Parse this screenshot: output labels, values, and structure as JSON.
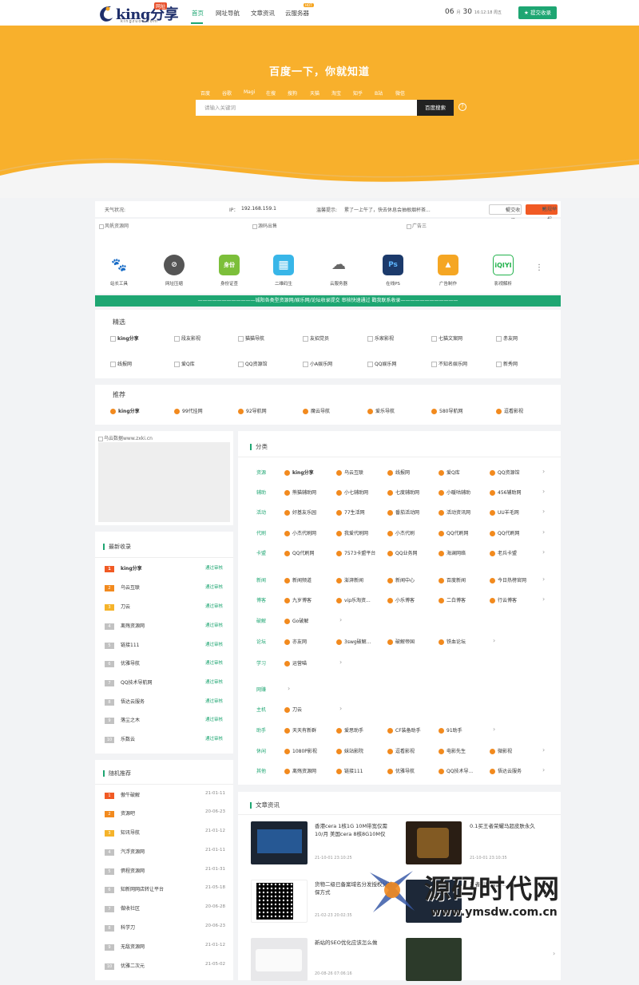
{
  "header": {
    "logo_text": "king分享",
    "logo_sub": "kingzuoo.com",
    "logo_tag": "网址",
    "nav": [
      "首页",
      "网址导航",
      "文章资讯",
      "云服务器"
    ],
    "hot_badge": "HOT",
    "date": {
      "month": "06",
      "month_unit": "月",
      "day": "30",
      "time_week": "16:12:18 周五"
    },
    "submit_label": "提交收录",
    "accent": "#1ea672"
  },
  "hero": {
    "title": "百度一下，你就知道",
    "engines": [
      "百度",
      "谷歌",
      "Magi",
      "在搜",
      "搜狗",
      "天猫",
      "淘宝",
      "知乎",
      "B站",
      "微信"
    ],
    "search_placeholder": "请输入关键词",
    "search_button": "百度搜索",
    "help": "?",
    "bg": "#f8b02c"
  },
  "info": {
    "weather_label": "天气状况:",
    "ip_label": "IP：",
    "ip_value": "192.168.159.1",
    "tip_label": "温馨提示:",
    "tip_text": "累了一上午了，快去休息会抽根烟杯茶...",
    "submit_btn": "提交收录",
    "report_btn": "违规举报"
  },
  "ads": [
    "风帆资源网",
    "源码出售",
    "广告三"
  ],
  "tools": [
    {
      "label": "站长工具",
      "icon": "paw-icon",
      "glyph": "🐾",
      "color": "#2b6fd6"
    },
    {
      "label": "网址压缩",
      "icon": "link-icon",
      "glyph": "⊘",
      "color": "#555555"
    },
    {
      "label": "身份证查",
      "icon": "id-card-icon",
      "glyph": "身份",
      "color": "#7cbf3a"
    },
    {
      "label": "二维码生",
      "icon": "qrcode-icon",
      "glyph": "▦",
      "color": "#38b6e8"
    },
    {
      "label": "云服务器",
      "icon": "cloud-icon",
      "glyph": "☁",
      "color": "#777777"
    },
    {
      "label": "在线PS",
      "icon": "ps-icon",
      "glyph": "Ps",
      "color": "#1c3a6b"
    },
    {
      "label": "广告制作",
      "icon": "image-icon",
      "glyph": "▲",
      "color": "#f5a623"
    },
    {
      "label": "影视解析",
      "icon": "iqiyi-icon",
      "glyph": "iQIYI",
      "color": "#22b24c"
    }
  ],
  "more": "⋮",
  "banner_text": "————————————城阳各类型资源网/娱乐网/论坛收录提交 审核快速通过 戳我联系收录————————————",
  "featured": {
    "title": "精选",
    "rows": [
      [
        "king分享",
        "段友影视",
        "猫猫导航",
        "友招党员",
        "乐家影视",
        "七猫文案网",
        "赤友网"
      ],
      [
        "线报网",
        "爱Q库",
        "QQ资源馆",
        "小A娱乐网",
        "QQ娱乐网",
        "不知名娱乐网",
        "新秀网"
      ]
    ]
  },
  "recommend": {
    "title": "推荐",
    "items": [
      "king分享",
      "99代挂网",
      "92导航网",
      "魔云导航",
      "爱乐导航",
      "580导航网",
      "逗看影视"
    ]
  },
  "left_ad": "乌云数据www.zxki.cn",
  "latest": {
    "title": "最新收录",
    "items": [
      "king分享",
      "乌云互联",
      "刀云",
      "离殇资源网",
      "链接111",
      "优雅导航",
      "QQ技术导航网",
      "悟达云服务",
      "落尘之木",
      "乐数云"
    ],
    "status": "通过审核"
  },
  "random": {
    "title": "随机推荐",
    "items": [
      {
        "name": "傲牛破解",
        "date": "21-01-11"
      },
      {
        "name": "资源吧",
        "date": "20-06-23"
      },
      {
        "name": "知讯导航",
        "date": "21-01-12"
      },
      {
        "name": "汽浮资源网",
        "date": "21-01-11"
      },
      {
        "name": "倶程资源网",
        "date": "21-01-31"
      },
      {
        "name": "知新网网店转让平台",
        "date": "21-05-18"
      },
      {
        "name": "做收社区",
        "date": "20-06-28"
      },
      {
        "name": "科学刀",
        "date": "20-06-23"
      },
      {
        "name": "无敌资源网",
        "date": "21-01-12"
      },
      {
        "name": "优雅二次元",
        "date": "21-05-02"
      }
    ]
  },
  "category": {
    "title": "分类",
    "rows": [
      {
        "label": "资源",
        "items": [
          "king分享",
          "乌云互联",
          "线报网",
          "爱Q库",
          "QQ资源馆"
        ]
      },
      {
        "label": "辅助",
        "items": [
          "熊猫辅助网",
          "小七辅助网",
          "七度辅助网",
          "小暖咕辅助",
          "456辅助网"
        ]
      },
      {
        "label": "活动",
        "items": [
          "好基友乐园",
          "77生活网",
          "番茄活动网",
          "活动资讯网",
          "UU羊毛网"
        ]
      },
      {
        "label": "代刷",
        "items": [
          "小杰代刷网",
          "我爱代刷网",
          "小杰代刷",
          "QQ代刷网",
          "QQ代刷网"
        ]
      },
      {
        "label": "卡盟",
        "items": [
          "QQ代刷网",
          "7573卡盟平台",
          "QQ业务网",
          "海澜网络",
          "老兵卡盟"
        ]
      },
      {
        "label": "新闻",
        "items": [
          "新闻频道",
          "澎湃新闻",
          "新闻中心",
          "百度新闻",
          "今日热榜官网"
        ]
      },
      {
        "label": "博客",
        "items": [
          "九岁博客",
          "vip乐淘资...",
          "小乐博客",
          "二白博客",
          "行云博客"
        ]
      },
      {
        "label": "破解",
        "items": [
          "Go破解"
        ]
      },
      {
        "label": "论坛",
        "items": [
          "亦友网",
          "3swg破解...",
          "破解帝国",
          "铁血论坛"
        ]
      },
      {
        "label": "学习",
        "items": [
          "运营喵"
        ]
      },
      {
        "label": "网赚",
        "items": []
      },
      {
        "label": "主机",
        "items": [
          "刀云"
        ]
      },
      {
        "label": "助手",
        "items": [
          "天天有新群",
          "爱思助手",
          "CF装备助手",
          "91助手"
        ]
      },
      {
        "label": "休闲",
        "items": [
          "1080P影视",
          "妹站影院",
          "逗看影视",
          "电影先生",
          "微影视"
        ]
      },
      {
        "label": "其他",
        "items": [
          "离殇资源网",
          "链接111",
          "优雅导航",
          "QQ技术导...",
          "悟达云服务"
        ]
      }
    ]
  },
  "articles": {
    "title": "文章资讯",
    "items": [
      {
        "title": "香港cera 1核1G 10M带宽仅需10/月 美国cera 8核8G10M仅",
        "date": "21-10-01 23:10:25"
      },
      {
        "title": "0.1买王者荣耀马超皮肤永久",
        "date": "21-10-01 23:10:35"
      },
      {
        "title": "货物二级已备案域名分发授权分销保方式",
        "date": "21-02-23 20:02:35"
      },
      {
        "title": "王者荣耀精选...",
        "date": ""
      },
      {
        "title": "新站的SEO优化应该怎么做",
        "date": "20-08-26 07:06:16"
      },
      {
        "title": "",
        "date": ""
      }
    ]
  },
  "watermark": {
    "text": "源码时代网",
    "url": "www.ymsdw.com.cn"
  }
}
